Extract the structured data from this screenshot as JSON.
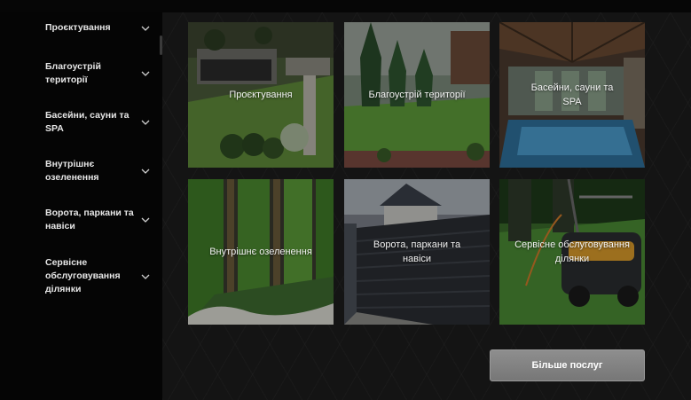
{
  "sidebar": {
    "items": [
      {
        "label": "Проєктування"
      },
      {
        "label": "Благоустрій території"
      },
      {
        "label": "Басейни, сауни та SPA"
      },
      {
        "label": "Внутрішнє озеленення"
      },
      {
        "label": "Ворота, паркани та навіси"
      },
      {
        "label": "Сервісне обслуговування ділянки"
      }
    ]
  },
  "services": [
    {
      "title": "Проєктування"
    },
    {
      "title": "Благоустрій території"
    },
    {
      "title": "Басейни, сауни та SPA"
    },
    {
      "title": "Внутрішнє озеленення"
    },
    {
      "title": "Ворота, паркани та навіси"
    },
    {
      "title": "Сервісне обслуговування ділянки"
    }
  ],
  "more_button": {
    "label": "Більше послуг"
  },
  "icons": {
    "sidebar_item": "chevron-down-icon"
  },
  "colors": {
    "background": "#141414",
    "sidebar": "#050505",
    "button": "#858585"
  }
}
